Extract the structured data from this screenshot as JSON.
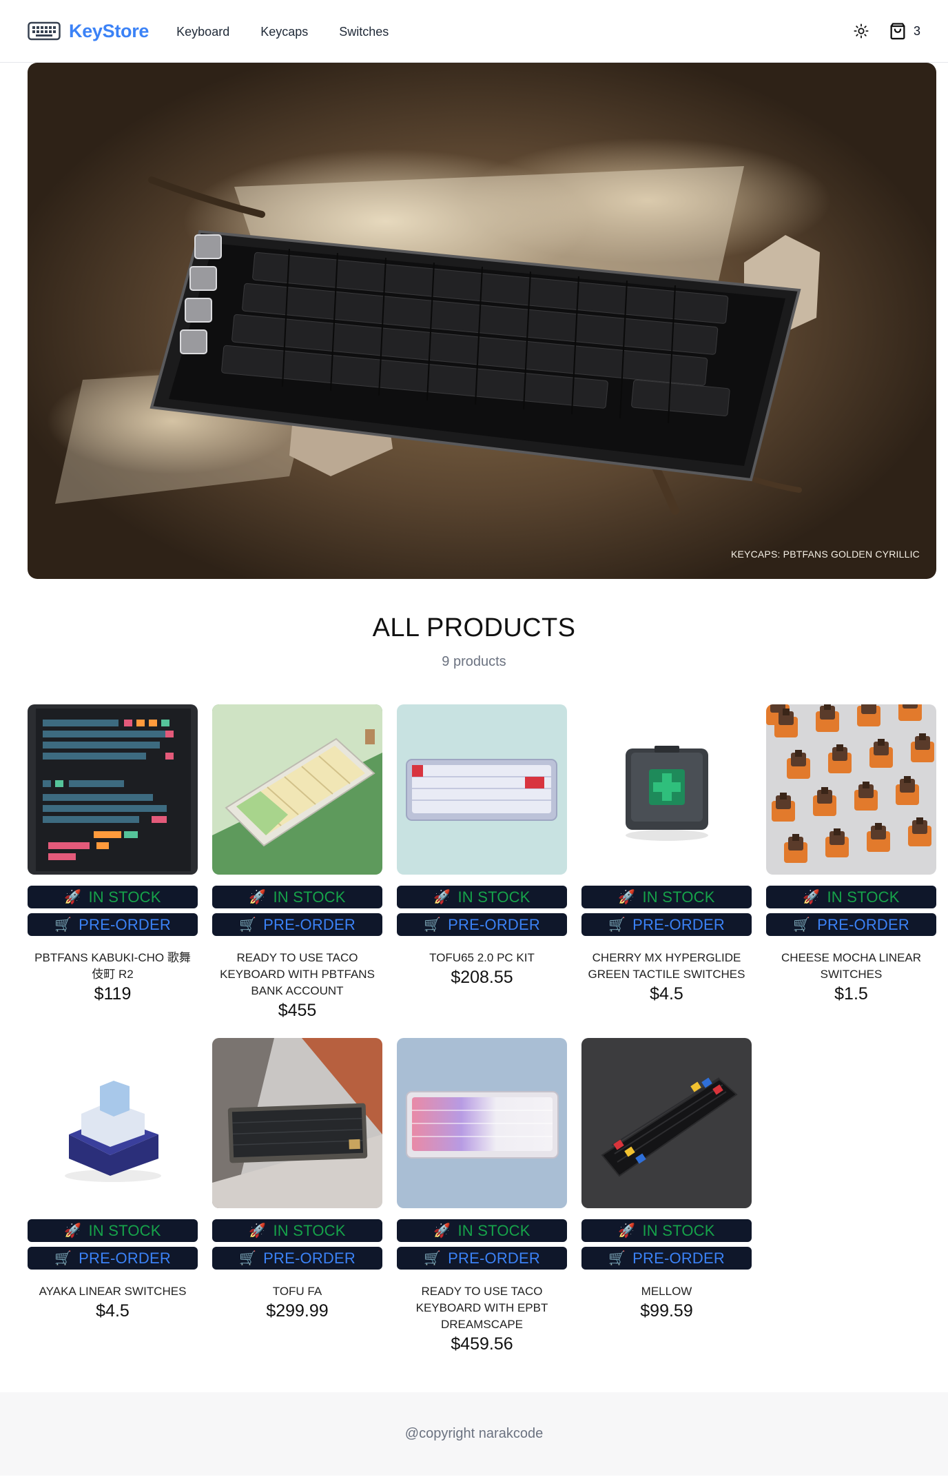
{
  "header": {
    "brand": "KeyStore",
    "nav": [
      "Keyboard",
      "Keycaps",
      "Switches"
    ],
    "cart_count": "3"
  },
  "hero": {
    "caption": "KEYCAPS: PBTFANS GOLDEN CYRILLIC"
  },
  "products": {
    "title": "ALL PRODUCTS",
    "count_label": "9 products",
    "stock_label": "IN STOCK",
    "preorder_label": "PRE-ORDER",
    "items": [
      {
        "name": "PBTFANS KABUKI-CHO 歌舞伎町 R2",
        "price": "$119",
        "image": "keycap-kit"
      },
      {
        "name": "READY TO USE TACO KEYBOARD WITH PBTFANS BANK ACCOUNT",
        "price": "$455",
        "image": "green-keyboard"
      },
      {
        "name": "TOFU65 2.0 PC KIT",
        "price": "$208.55",
        "image": "white-keyboard"
      },
      {
        "name": "CHERRY MX HYPERGLIDE GREEN TACTILE SWITCHES",
        "price": "$4.5",
        "image": "green-switch"
      },
      {
        "name": "CHEESE MOCHA LINEAR SWITCHES",
        "price": "$1.5",
        "image": "orange-switches"
      },
      {
        "name": "AYAKA LINEAR SWITCHES",
        "price": "$4.5",
        "image": "blue-switch"
      },
      {
        "name": "TOFU FA",
        "price": "$299.99",
        "image": "dark-keyboard"
      },
      {
        "name": "READY TO USE TACO KEYBOARD WITH EPBT DREAMSCAPE",
        "price": "$459.56",
        "image": "pastel-keyboard"
      },
      {
        "name": "MELLOW",
        "price": "$99.59",
        "image": "black-keyboard"
      }
    ]
  },
  "footer": {
    "text": "@copyright narakcode"
  },
  "colors": {
    "brand": "#3b82f6",
    "badge_bg": "#0f172a",
    "in_stock": "#16a34a",
    "pre_order": "#3b82f6"
  },
  "icons": {
    "stock": "rocket-icon",
    "preorder": "cart-icon"
  }
}
